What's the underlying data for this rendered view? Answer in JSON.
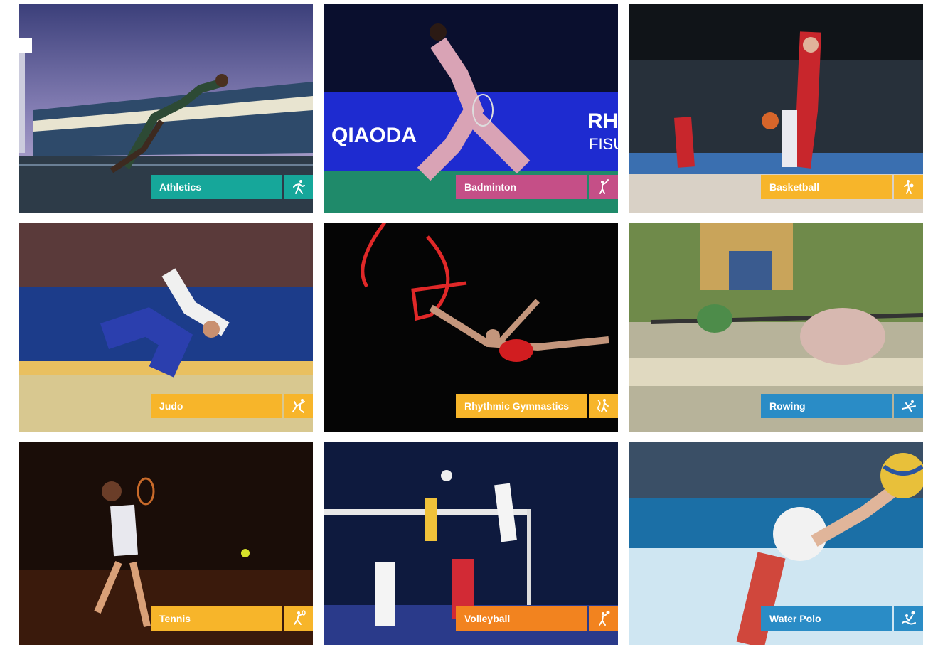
{
  "tiles": [
    {
      "label": "Athletics",
      "color": "#16a79a",
      "icon": "athletics-runner-icon"
    },
    {
      "label": "Badminton",
      "color": "#c54f87",
      "icon": "badminton-player-icon"
    },
    {
      "label": "Basketball",
      "color": "#f7b52a",
      "icon": "basketball-player-icon"
    },
    {
      "label": "Judo",
      "color": "#f7b52a",
      "icon": "judo-throw-icon"
    },
    {
      "label": "Rhythmic Gymnastics",
      "color": "#f7b52a",
      "icon": "gymnast-ribbon-icon"
    },
    {
      "label": "Rowing",
      "color": "#2a8cc6",
      "icon": "rowing-icon"
    },
    {
      "label": "Tennis",
      "color": "#f7b52a",
      "icon": "tennis-player-icon"
    },
    {
      "label": "Volleyball",
      "color": "#f2831f",
      "icon": "volleyball-player-icon"
    },
    {
      "label": "Water Polo",
      "color": "#2a8cc6",
      "icon": "water-polo-icon"
    }
  ]
}
